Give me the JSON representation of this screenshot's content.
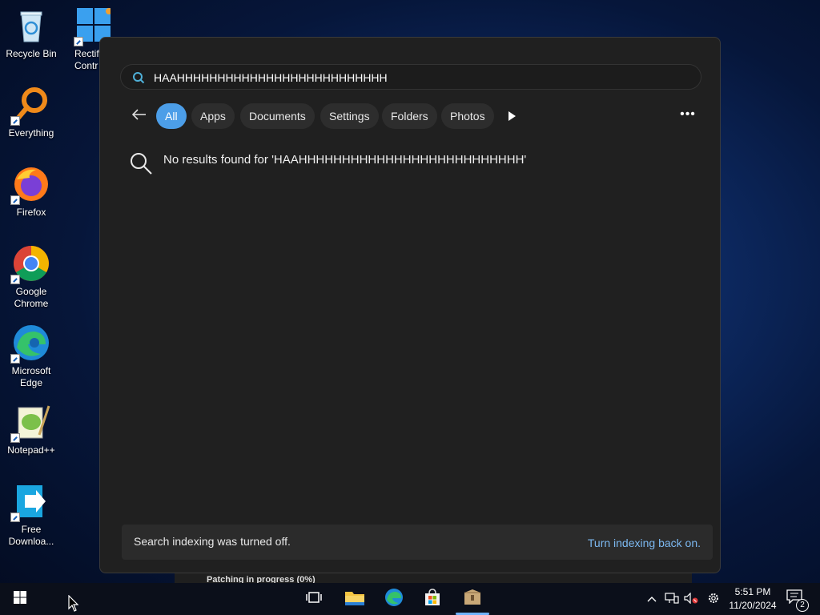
{
  "desktop": {
    "icons": [
      {
        "label": "Recycle Bin",
        "icon": "recycle-bin-icon"
      },
      {
        "label": "Rectify\nContr",
        "icon": "windows-logo-icon"
      },
      {
        "label": "Everything",
        "icon": "everything-search-icon"
      },
      {
        "label": "Firefox",
        "icon": "firefox-icon"
      },
      {
        "label": "Google\nChrome",
        "icon": "chrome-icon"
      },
      {
        "label": "Microsoft\nEdge",
        "icon": "edge-icon"
      },
      {
        "label": "Notepad++",
        "icon": "notepadpp-icon"
      },
      {
        "label": "Free\nDownloa...",
        "icon": "free-download-manager-icon"
      }
    ]
  },
  "search": {
    "query": "HAAHHHHHHHHHHHHHHHHHHHHHHHHHH",
    "filters": [
      "All",
      "Apps",
      "Documents",
      "Settings",
      "Folders",
      "Photos"
    ],
    "active_filter": "All",
    "no_results": "No results found for 'HAAHHHHHHHHHHHHHHHHHHHHHHHHHH'",
    "indexing_message": "Search indexing was turned off.",
    "indexing_link": "Turn indexing back on."
  },
  "background_window": {
    "partial_text": "Patching in progress (0%)"
  },
  "taskbar": {
    "pinned": [
      "start-button",
      "task-view-icon",
      "file-explorer-icon",
      "edge-icon",
      "microsoft-store-icon",
      "package-installer-icon"
    ],
    "time": "5:51 PM",
    "date": "11/20/2024",
    "notifications_count": "2"
  },
  "colors": {
    "accent": "#4c9ee8",
    "link": "#7cb8f0",
    "panel_bg": "#202020"
  }
}
